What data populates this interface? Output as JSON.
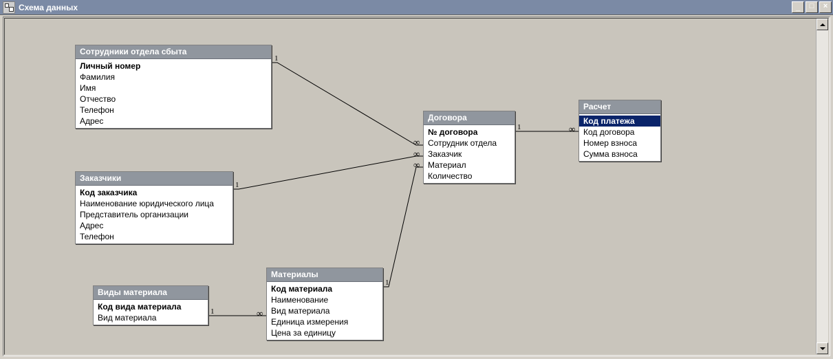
{
  "window": {
    "title": "Схема данных",
    "buttons": {
      "minimize": "_",
      "maximize": "□",
      "close": "×"
    }
  },
  "tables": {
    "employees": {
      "title": "Сотрудники отдела сбыта",
      "pk": "Личный номер",
      "fields": [
        "Фамилия",
        "Имя",
        "Отчество",
        "Телефон",
        "Адрес"
      ]
    },
    "customers": {
      "title": "Заказчики",
      "pk": "Код заказчика",
      "fields": [
        "Наименование юридического лица",
        "Представитель организации",
        "Адрес",
        "Телефон"
      ]
    },
    "material_kinds": {
      "title": "Виды материала",
      "pk": "Код вида материала",
      "fields": [
        "Вид материала"
      ]
    },
    "materials": {
      "title": "Материалы",
      "pk": "Код материала",
      "fields": [
        "Наименование",
        "Вид материала",
        "Единица измерения",
        "Цена за единицу"
      ]
    },
    "contracts": {
      "title": "Договора",
      "pk": "№ договора",
      "fields": [
        "Сотрудник отдела",
        "Заказчик",
        "Материал",
        "Количество"
      ]
    },
    "payment": {
      "title": "Расчет",
      "pk_selected": "Код платежа",
      "fields": [
        "Код договора",
        "Номер взноса",
        "Сумма взноса"
      ]
    }
  },
  "cardinality": {
    "one": "1",
    "many": "∞"
  }
}
